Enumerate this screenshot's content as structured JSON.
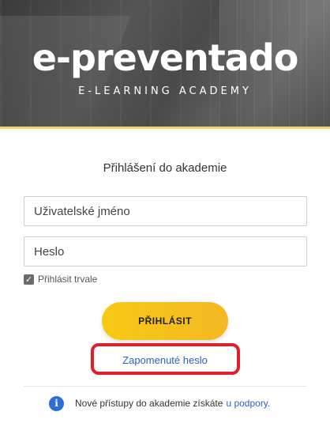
{
  "header": {
    "logo": "e-preventado",
    "tagline": "E-LEARNING ACADEMY"
  },
  "login": {
    "title": "Přihlášení do akademie",
    "username_placeholder": "Uživatelské jméno",
    "password_placeholder": "Heslo",
    "remember_label": "Přihlásit trvale",
    "remember_checked": true,
    "submit_label": "PŘIHLÁSIT",
    "forgot_label": "Zapomenuté heslo"
  },
  "info": {
    "text": "Nové přístupy do akademie získáte",
    "link_label": "u podpory."
  },
  "colors": {
    "accent_yellow": "#f8c915",
    "link_blue": "#2b62c3",
    "highlight_red": "#e01f2a",
    "info_blue": "#2b6fd6"
  }
}
